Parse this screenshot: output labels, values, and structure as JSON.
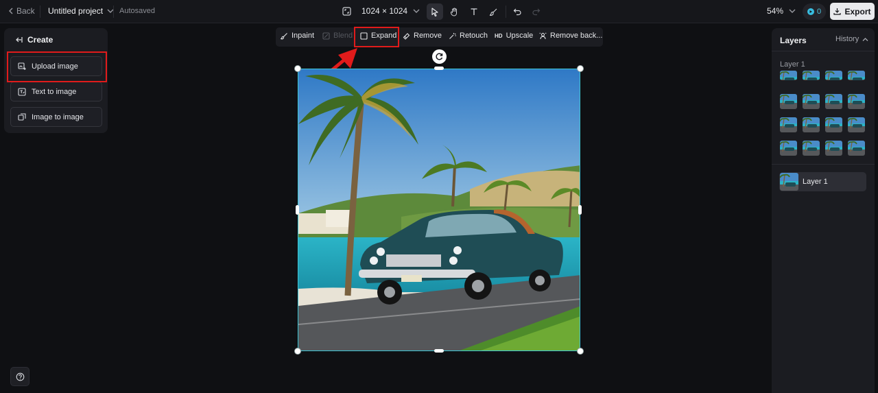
{
  "topbar": {
    "back_label": "Back",
    "project_title": "Untitled project",
    "autosaved": "Autosaved",
    "canvas_size": "1024 × 1024",
    "zoom": "54%",
    "credits": "0",
    "export_label": "Export"
  },
  "left_panel": {
    "header": "Create",
    "buttons": [
      "Upload image",
      "Text to image",
      "Image to image"
    ]
  },
  "image_toolbar": {
    "inpaint": "Inpaint",
    "blend": "Blend",
    "expand": "Expand",
    "remove": "Remove",
    "retouch": "Retouch",
    "upscale_prefix": "HD",
    "upscale": "Upscale",
    "remove_background": "Remove back..."
  },
  "right_panel": {
    "tab_layers": "Layers",
    "tab_history": "History",
    "group_label": "Layer 1",
    "layer_item": "Layer 1"
  },
  "colors": {
    "accent_highlight": "#e11b1b",
    "selection_border": "#3ec6d6",
    "credits_accent": "#38bde0"
  }
}
